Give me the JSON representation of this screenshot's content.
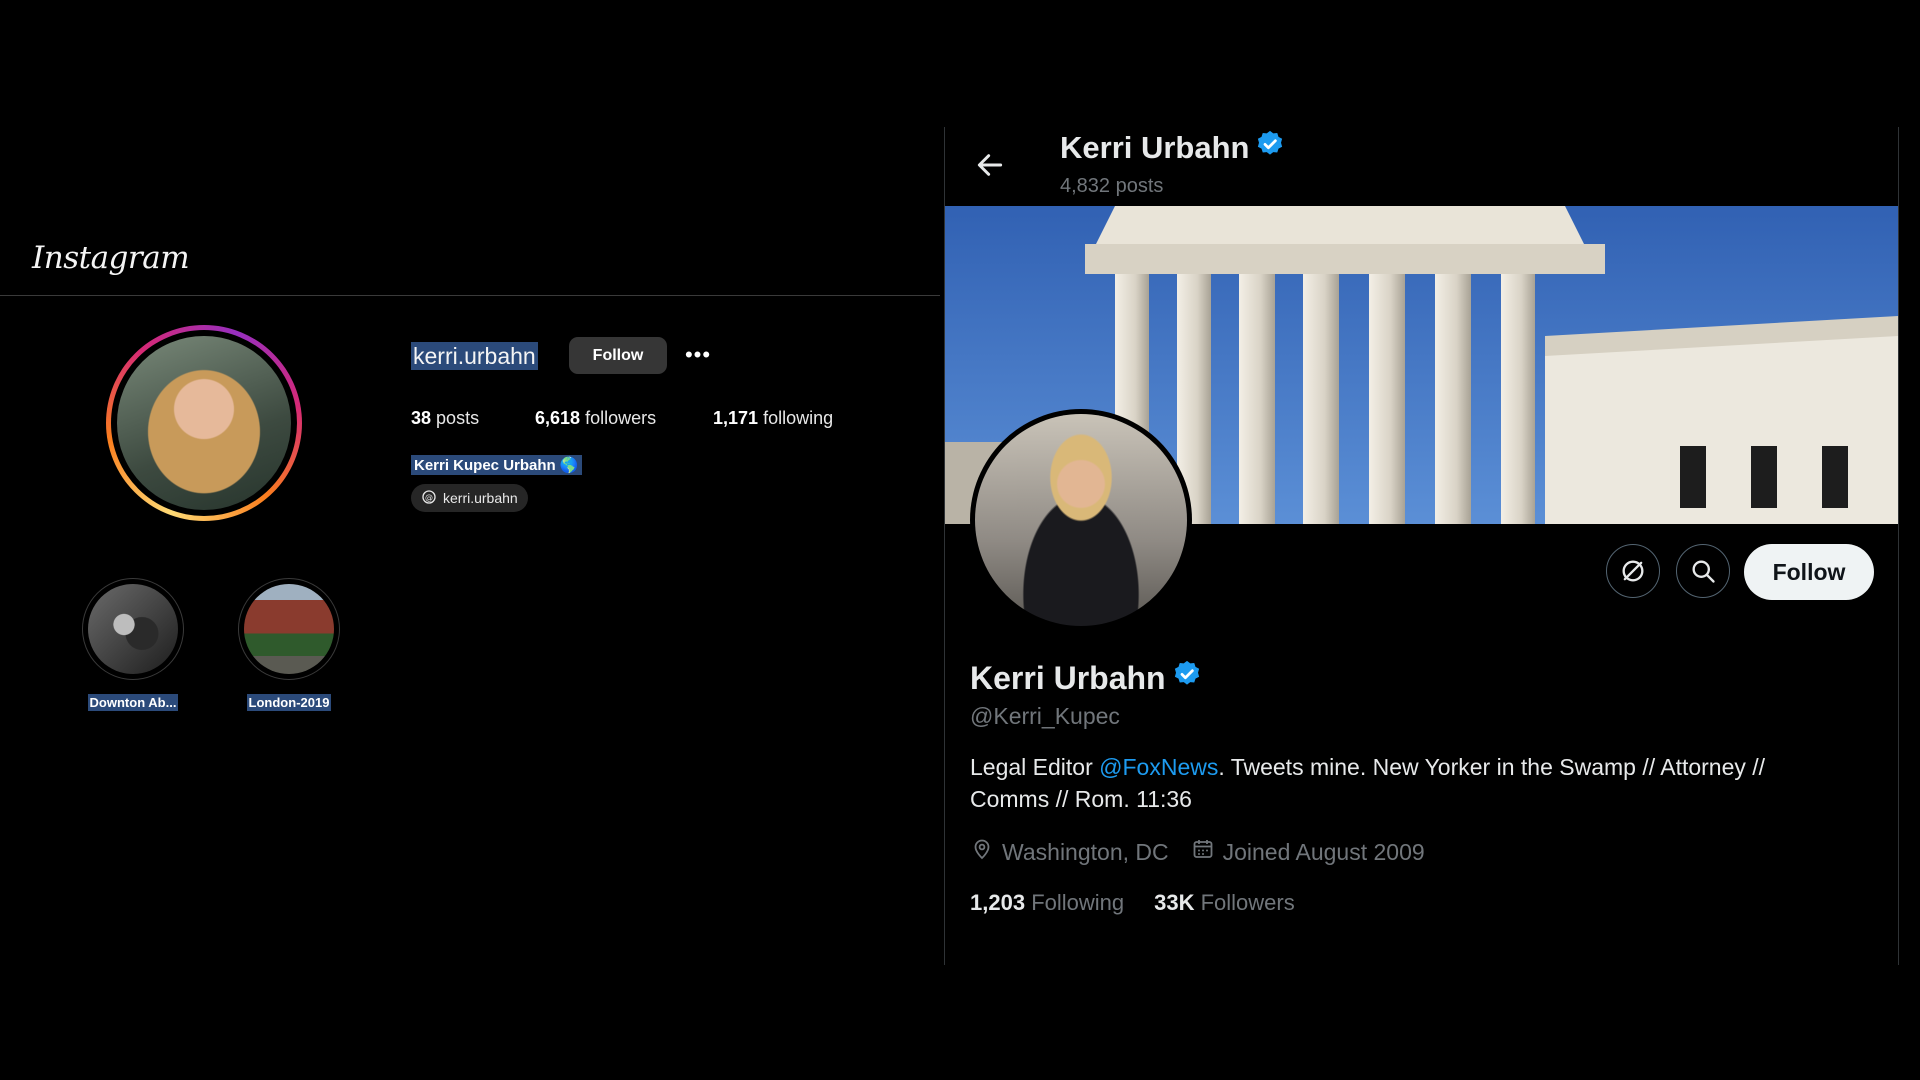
{
  "instagram": {
    "logo": "Instagram",
    "username": "kerri.urbahn",
    "follow_label": "Follow",
    "more_label": "•••",
    "stats": {
      "posts_count": "38",
      "posts_label": "posts",
      "followers_count": "6,618",
      "followers_label": "followers",
      "following_count": "1,171",
      "following_label": "following"
    },
    "full_name": "Kerri Kupec Urbahn 🌎",
    "threads_handle": "kerri.urbahn",
    "highlights": [
      {
        "label": "Downton Ab..."
      },
      {
        "label": "London-2019"
      }
    ]
  },
  "twitter": {
    "header_name": "Kerri Urbahn",
    "header_posts": "4,832 posts",
    "follow_label": "Follow",
    "name": "Kerri Urbahn",
    "handle": "@Kerri_Kupec",
    "bio_before": "Legal Editor ",
    "bio_link": "@FoxNews",
    "bio_after": ". Tweets mine. New Yorker in the Swamp // Attorney // Comms // Rom. 11:36",
    "location": "Washington, DC",
    "joined": "Joined August 2009",
    "following_count": "1,203",
    "following_label": "Following",
    "followers_count": "33K",
    "followers_label": "Followers",
    "colors": {
      "verified": "#1d9bf0",
      "link": "#1d9bf0",
      "muted": "#71767b"
    }
  },
  "icons": [
    "back-arrow-icon",
    "verified-badge-icon",
    "grok-icon",
    "search-icon",
    "location-pin-icon",
    "calendar-icon",
    "threads-icon"
  ]
}
